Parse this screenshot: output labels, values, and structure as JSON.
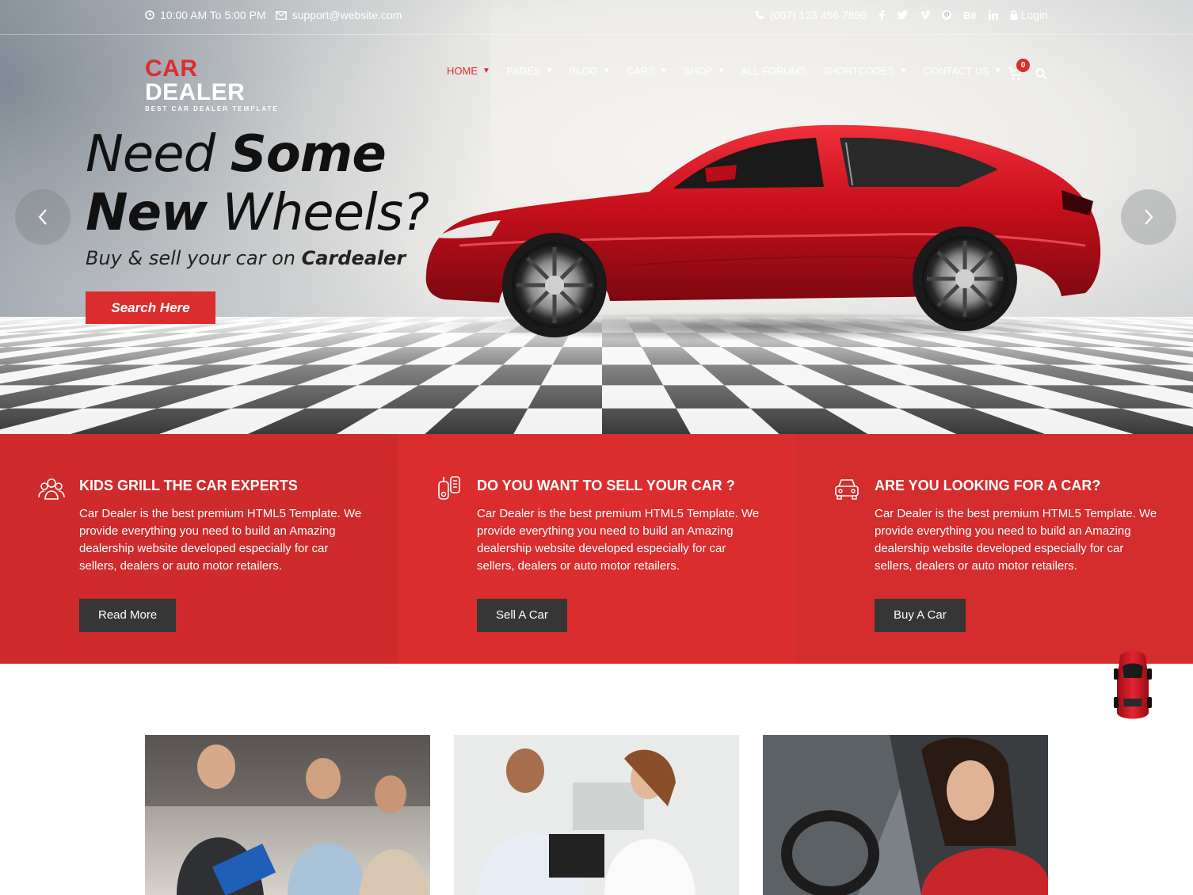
{
  "topbar": {
    "hours": "10:00 AM To 5:00 PM",
    "email": "support@website.com",
    "phone": "(007) 123 456 7890",
    "social_icons": [
      "facebook-icon",
      "twitter-icon",
      "vimeo-icon",
      "pinterest-icon",
      "behance-icon",
      "linkedin-icon"
    ],
    "login": "Login"
  },
  "logo": {
    "part1": "CAR",
    "part2": "DEALER",
    "tagline": "BEST CAR DEALER TEMPLATE"
  },
  "nav": {
    "items": [
      {
        "label": "HOME",
        "has_dropdown": true,
        "active": true
      },
      {
        "label": "PAGES",
        "has_dropdown": true
      },
      {
        "label": "BLOG",
        "has_dropdown": true
      },
      {
        "label": "CARS",
        "has_dropdown": true
      },
      {
        "label": "SHOP",
        "has_dropdown": true
      },
      {
        "label": "ALL FORUMS",
        "has_dropdown": false
      },
      {
        "label": "SHORTCODES",
        "has_dropdown": true
      },
      {
        "label": "CONTACT US",
        "has_dropdown": true
      }
    ],
    "cart_count": "0"
  },
  "hero": {
    "line1_light": "Need",
    "line1_bold": "Some",
    "line2_bold": "New",
    "line2_light": "Wheels?",
    "subtitle_pre": "Buy & sell your car on",
    "subtitle_brand": "Cardealer",
    "button": "Search Here"
  },
  "features": [
    {
      "icon": "people-group-icon",
      "title": "KIDS GRILL THE CAR EXPERTS",
      "body": "Car Dealer is the best premium HTML5 Template. We provide everything you need to build an Amazing dealership website developed especially for car sellers, dealers or auto motor retailers.",
      "button": "Read More"
    },
    {
      "icon": "car-key-icon",
      "title": "DO YOU WANT TO SELL YOUR CAR ?",
      "body": "Car Dealer is the best premium HTML5 Template. We provide everything you need to build an Amazing dealership website developed especially for car sellers, dealers or auto motor retailers.",
      "button": "Sell A Car"
    },
    {
      "icon": "car-front-icon",
      "title": "ARE YOU LOOKING FOR A CAR?",
      "body": "Car Dealer is the best premium HTML5 Template. We provide everything you need to build an Amazing dealership website developed especially for car sellers, dealers or auto motor retailers.",
      "button": "Buy A Car"
    }
  ],
  "colors": {
    "accent": "#db2d2e",
    "dark_button": "#363636"
  }
}
